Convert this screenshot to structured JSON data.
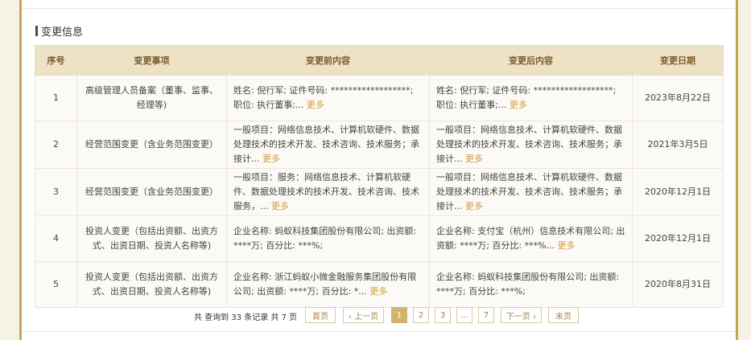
{
  "section_title": "变更信息",
  "table": {
    "headers": [
      "序号",
      "变更事项",
      "变更前内容",
      "变更后内容",
      "变更日期"
    ],
    "rows": [
      {
        "no": "1",
        "item": "高级管理人员备案（董事、监事、经理等)",
        "before": "姓名: 倪行军; 证件号码: ******************; 职位: 执行董事;...",
        "after": "姓名: 倪行军; 证件号码: ******************; 职位: 执行董事;...",
        "date": "2023年8月22日"
      },
      {
        "no": "2",
        "item": "经营范围变更（含业务范围变更）",
        "before": "一般项目：网络信息技术、计算机软硬件、数据处理技术的技术开发、技术咨询、技术服务；承接计...",
        "after": "一般项目：网络信息技术、计算机软硬件、数据处理技术的技术开发、技术咨询、技术服务；承接计...",
        "date": "2021年3月5日"
      },
      {
        "no": "3",
        "item": "经营范围变更（含业务范围变更）",
        "before": "一般项目：服务：网络信息技术、计算机软硬件、数据处理技术的技术开发、技术咨询、技术服务，...",
        "after": "一般项目：网络信息技术、计算机软硬件、数据处理技术的技术开发、技术咨询、技术服务；承接计...",
        "date": "2020年12月1日"
      },
      {
        "no": "4",
        "item": "投资人变更（包括出资额、出资方式、出资日期、投资人名称等)",
        "before": "企业名称: 蚂蚁科技集团股份有限公司; 出资额: ****万; 百分比: ***%;",
        "after": "企业名称: 支付宝（杭州）信息技术有限公司; 出资额: ****万; 百分比: ***%...",
        "date": "2020年12月1日"
      },
      {
        "no": "5",
        "item": "投资人变更（包括出资额、出资方式、出资日期、投资人名称等)",
        "before": "企业名称: 浙江蚂蚁小微金融服务集团股份有限公司; 出资额: ****万; 百分比: *...",
        "after": "企业名称: 蚂蚁科技集团股份有限公司; 出资额: ****万; 百分比: ***%;",
        "date": "2020年8月31日"
      }
    ],
    "more_label": "更多"
  },
  "pagination": {
    "total_text": "共 查询到 33 条记录 共 7 页",
    "first": "首页",
    "prev": "‹ 上一页",
    "pages": [
      "1",
      "2",
      "3",
      "...",
      "7"
    ],
    "next": "下一页 ›",
    "last": "末页",
    "current": "1"
  }
}
